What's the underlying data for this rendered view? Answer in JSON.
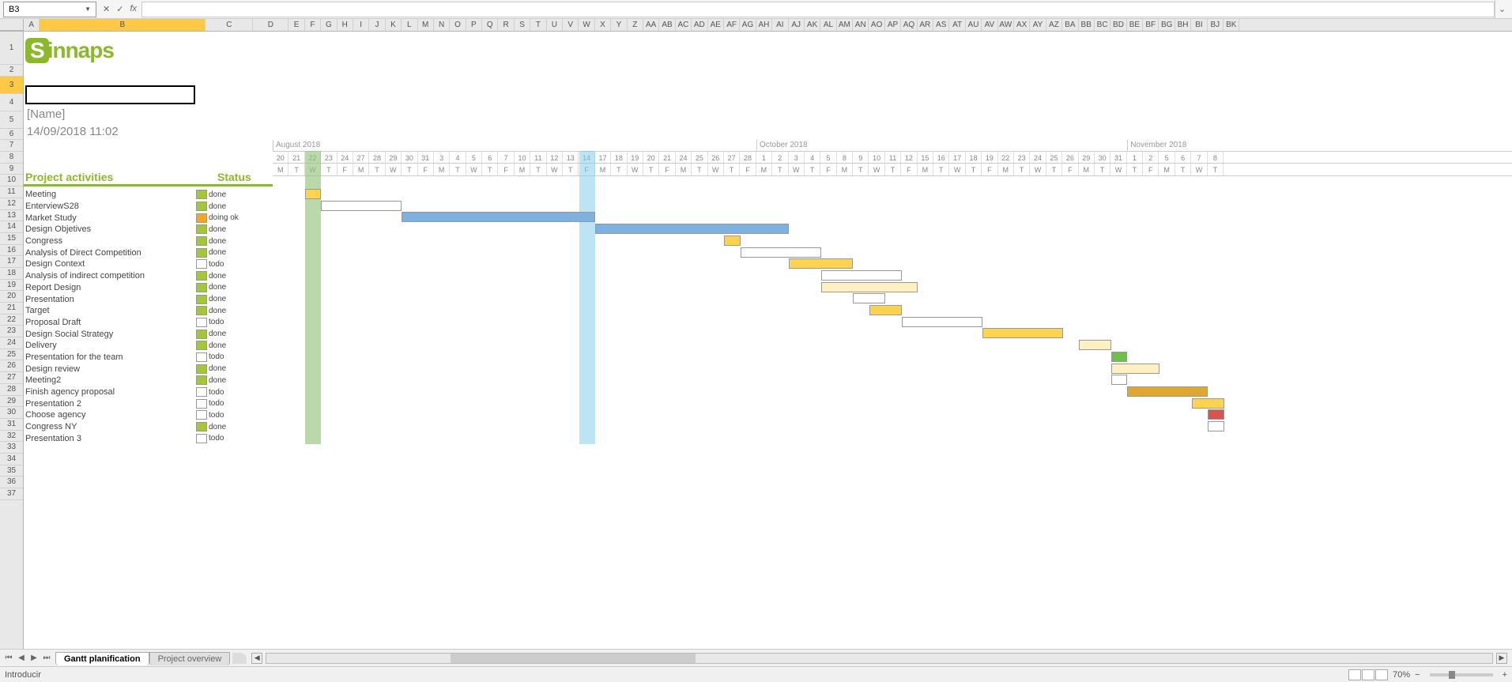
{
  "formula": {
    "cell_ref": "B3",
    "cancel": "✕",
    "enter": "✓",
    "fx": "fx",
    "value": ""
  },
  "columns": [
    "A",
    "B",
    "C",
    "D",
    "E",
    "F",
    "G",
    "H",
    "I",
    "J",
    "K",
    "L",
    "M",
    "N",
    "O",
    "P",
    "Q",
    "R",
    "S",
    "T",
    "U",
    "V",
    "W",
    "X",
    "Y",
    "Z",
    "AA",
    "AB",
    "AC",
    "AD",
    "AE",
    "AF",
    "AG",
    "AH",
    "AI",
    "AJ",
    "AK",
    "AL",
    "AM",
    "AN",
    "AO",
    "AP",
    "AQ",
    "AR",
    "AS",
    "AT",
    "AU",
    "AV",
    "AW",
    "AX",
    "AY",
    "AZ",
    "BA",
    "BB",
    "BC",
    "BD",
    "BE",
    "BF",
    "BG",
    "BH",
    "BI",
    "BJ",
    "BK"
  ],
  "rows": [
    1,
    2,
    3,
    4,
    5,
    6,
    7,
    8,
    9,
    10,
    11,
    12,
    13,
    14,
    15,
    16,
    17,
    18,
    19,
    20,
    21,
    22,
    23,
    24,
    25,
    26,
    27,
    28,
    29,
    30,
    31,
    32,
    33,
    34,
    35,
    36,
    37
  ],
  "logo": "innaps",
  "name_placeholder": "[Name]",
  "date": "14/09/2018 11:02",
  "header_activities": "Project activities",
  "header_status": "Status",
  "activities": [
    {
      "name": "Meeting",
      "status": "done",
      "color": "#a4c639"
    },
    {
      "name": "EnterviewS28",
      "status": "done",
      "color": "#a4c639"
    },
    {
      "name": "Market Study",
      "status": "doing ok",
      "color": "#f5a623"
    },
    {
      "name": "Design Objetives",
      "status": "done",
      "color": "#a4c639"
    },
    {
      "name": "Congress",
      "status": "done",
      "color": "#a4c639"
    },
    {
      "name": "Analysis of Direct Competition",
      "status": "done",
      "color": "#a4c639"
    },
    {
      "name": "Design Context",
      "status": "todo",
      "color": "#ffffff"
    },
    {
      "name": "Analysis of indirect competition",
      "status": "done",
      "color": "#a4c639"
    },
    {
      "name": "Report Design",
      "status": "done",
      "color": "#a4c639"
    },
    {
      "name": "Presentation",
      "status": "done",
      "color": "#a4c639"
    },
    {
      "name": "Target",
      "status": "done",
      "color": "#a4c639"
    },
    {
      "name": "Proposal Draft",
      "status": "todo",
      "color": "#ffffff"
    },
    {
      "name": "Design Social Strategy",
      "status": "done",
      "color": "#a4c639"
    },
    {
      "name": "Delivery",
      "status": "done",
      "color": "#a4c639"
    },
    {
      "name": "Presentation for the team",
      "status": "todo",
      "color": "#ffffff"
    },
    {
      "name": "Design review",
      "status": "done",
      "color": "#a4c639"
    },
    {
      "name": "Meeting2",
      "status": "done",
      "color": "#a4c639"
    },
    {
      "name": "Finish agency proposal",
      "status": "todo",
      "color": "#ffffff"
    },
    {
      "name": "Presentation 2",
      "status": "todo",
      "color": "#ffffff"
    },
    {
      "name": "Choose agency",
      "status": "todo",
      "color": "#ffffff"
    },
    {
      "name": "Congress NY",
      "status": "done",
      "color": "#a4c639"
    },
    {
      "name": "Presentation 3",
      "status": "todo",
      "color": "#ffffff"
    }
  ],
  "months": [
    {
      "label": "August 2018",
      "span": 30
    },
    {
      "label": "October 2018",
      "span": 23
    },
    {
      "label": "November 2018",
      "span": 6
    }
  ],
  "days": [
    20,
    21,
    22,
    23,
    24,
    27,
    28,
    29,
    30,
    31,
    3,
    4,
    5,
    6,
    7,
    10,
    11,
    12,
    13,
    14,
    17,
    18,
    19,
    20,
    21,
    24,
    25,
    26,
    27,
    28,
    1,
    2,
    3,
    4,
    5,
    8,
    9,
    10,
    11,
    12,
    15,
    16,
    17,
    18,
    19,
    22,
    23,
    24,
    25,
    26,
    29,
    30,
    31,
    1,
    2,
    5,
    6,
    7,
    8
  ],
  "dow": [
    "M",
    "T",
    "W",
    "T",
    "F",
    "M",
    "T",
    "W",
    "T",
    "F",
    "M",
    "T",
    "W",
    "T",
    "F",
    "M",
    "T",
    "W",
    "T",
    "F",
    "M",
    "T",
    "W",
    "T",
    "F",
    "M",
    "T",
    "W",
    "T",
    "F",
    "M",
    "T",
    "W",
    "T",
    "F",
    "M",
    "T",
    "W",
    "T",
    "F",
    "M",
    "T",
    "W",
    "T",
    "F",
    "M",
    "T",
    "W",
    "T",
    "F",
    "M",
    "T",
    "W",
    "T",
    "F",
    "M",
    "T",
    "W",
    "T"
  ],
  "chart_data": {
    "type": "gantt",
    "today_col_index": 19,
    "green_col_index": 2,
    "bars": [
      {
        "row": 0,
        "start": 2,
        "end": 3,
        "fill": "#ffd34e"
      },
      {
        "row": 1,
        "start": 3,
        "end": 8,
        "fill": "#ffffff"
      },
      {
        "row": 2,
        "start": 8,
        "end": 20,
        "fill": "#7fb1e0"
      },
      {
        "row": 3,
        "start": 20,
        "end": 32,
        "fill": "#7fb1e0"
      },
      {
        "row": 4,
        "start": 28,
        "end": 29,
        "fill": "#ffd34e"
      },
      {
        "row": 5,
        "start": 29,
        "end": 34,
        "fill": "#ffffff"
      },
      {
        "row": 6,
        "start": 32,
        "end": 36,
        "fill": "#ffd34e"
      },
      {
        "row": 7,
        "start": 34,
        "end": 39,
        "fill": "#ffffff"
      },
      {
        "row": 8,
        "start": 34,
        "end": 40,
        "fill": "#fff0c2"
      },
      {
        "row": 9,
        "start": 36,
        "end": 38,
        "fill": "#ffffff"
      },
      {
        "row": 10,
        "start": 37,
        "end": 39,
        "fill": "#ffd34e"
      },
      {
        "row": 11,
        "start": 39,
        "end": 44,
        "fill": "#ffffff"
      },
      {
        "row": 12,
        "start": 44,
        "end": 49,
        "fill": "#ffd34e"
      },
      {
        "row": 13,
        "start": 50,
        "end": 52,
        "fill": "#fff0c2"
      },
      {
        "row": 14,
        "start": 52,
        "end": 53,
        "fill": "#6fbf4b"
      },
      {
        "row": 15,
        "start": 52,
        "end": 55,
        "fill": "#fff0c2"
      },
      {
        "row": 16,
        "start": 52,
        "end": 53,
        "fill": "#ffffff"
      },
      {
        "row": 17,
        "start": 53,
        "end": 58,
        "fill": "#e0a82e"
      },
      {
        "row": 18,
        "start": 57,
        "end": 59,
        "fill": "#ffd34e"
      },
      {
        "row": 19,
        "start": 58,
        "end": 59,
        "fill": "#d9534f"
      },
      {
        "row": 20,
        "start": 58,
        "end": 59,
        "fill": "#ffffff"
      }
    ]
  },
  "tabs": [
    {
      "label": "Gantt planification",
      "active": true
    },
    {
      "label": "Project overview",
      "active": false
    }
  ],
  "status_text": "Introducir",
  "zoom": "70%"
}
